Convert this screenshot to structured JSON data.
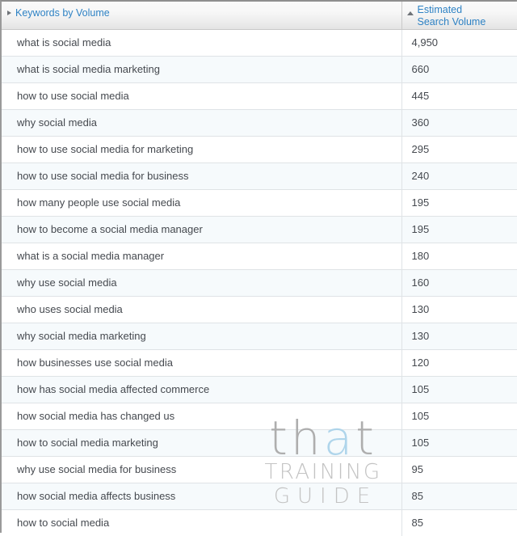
{
  "table": {
    "columns": [
      {
        "key": "keyword",
        "label": "Keywords by Volume",
        "sort_icon": "caret-right-icon",
        "sort_state": "collapsed"
      },
      {
        "key": "volume",
        "label_line1": "Estimated",
        "label_line2": "Search Volume",
        "sort_icon": "caret-up-icon",
        "sort_state": "ascending"
      }
    ],
    "rows": [
      {
        "keyword": "what is social media",
        "volume": "4,950"
      },
      {
        "keyword": "what is social media marketing",
        "volume": "660"
      },
      {
        "keyword": "how to use social media",
        "volume": "445"
      },
      {
        "keyword": "why social media",
        "volume": "360"
      },
      {
        "keyword": "how to use social media for marketing",
        "volume": "295"
      },
      {
        "keyword": "how to use social media for business",
        "volume": "240"
      },
      {
        "keyword": "how many people use social media",
        "volume": "195"
      },
      {
        "keyword": "how to become a social media manager",
        "volume": "195"
      },
      {
        "keyword": "what is a social media manager",
        "volume": "180"
      },
      {
        "keyword": "why use social media",
        "volume": "160"
      },
      {
        "keyword": "who uses social media",
        "volume": "130"
      },
      {
        "keyword": "why social media marketing",
        "volume": "130"
      },
      {
        "keyword": "how businesses use social media",
        "volume": "120"
      },
      {
        "keyword": "how has social media affected commerce",
        "volume": "105"
      },
      {
        "keyword": "how social media has changed us",
        "volume": "105"
      },
      {
        "keyword": "how to social media marketing",
        "volume": "105"
      },
      {
        "keyword": "why use social media for business",
        "volume": "95"
      },
      {
        "keyword": "how social media affects business",
        "volume": "85"
      },
      {
        "keyword": "how to social media",
        "volume": "85"
      }
    ]
  },
  "watermark": {
    "line1_part1": "th",
    "line1_part2": "a",
    "line1_part3": "t",
    "line2": "TRAINING",
    "line3": "GUIDE"
  },
  "colors": {
    "header_link": "#2e82c4",
    "body_text": "#45494f",
    "row_alt_bg": "#f6fafc",
    "row_bg": "#ffffff",
    "grid_line": "#dfe3e6",
    "outer_border": "#9a9a9a",
    "watermark_gray": "#a8a8a8",
    "watermark_blue": "#a9d2ea"
  }
}
